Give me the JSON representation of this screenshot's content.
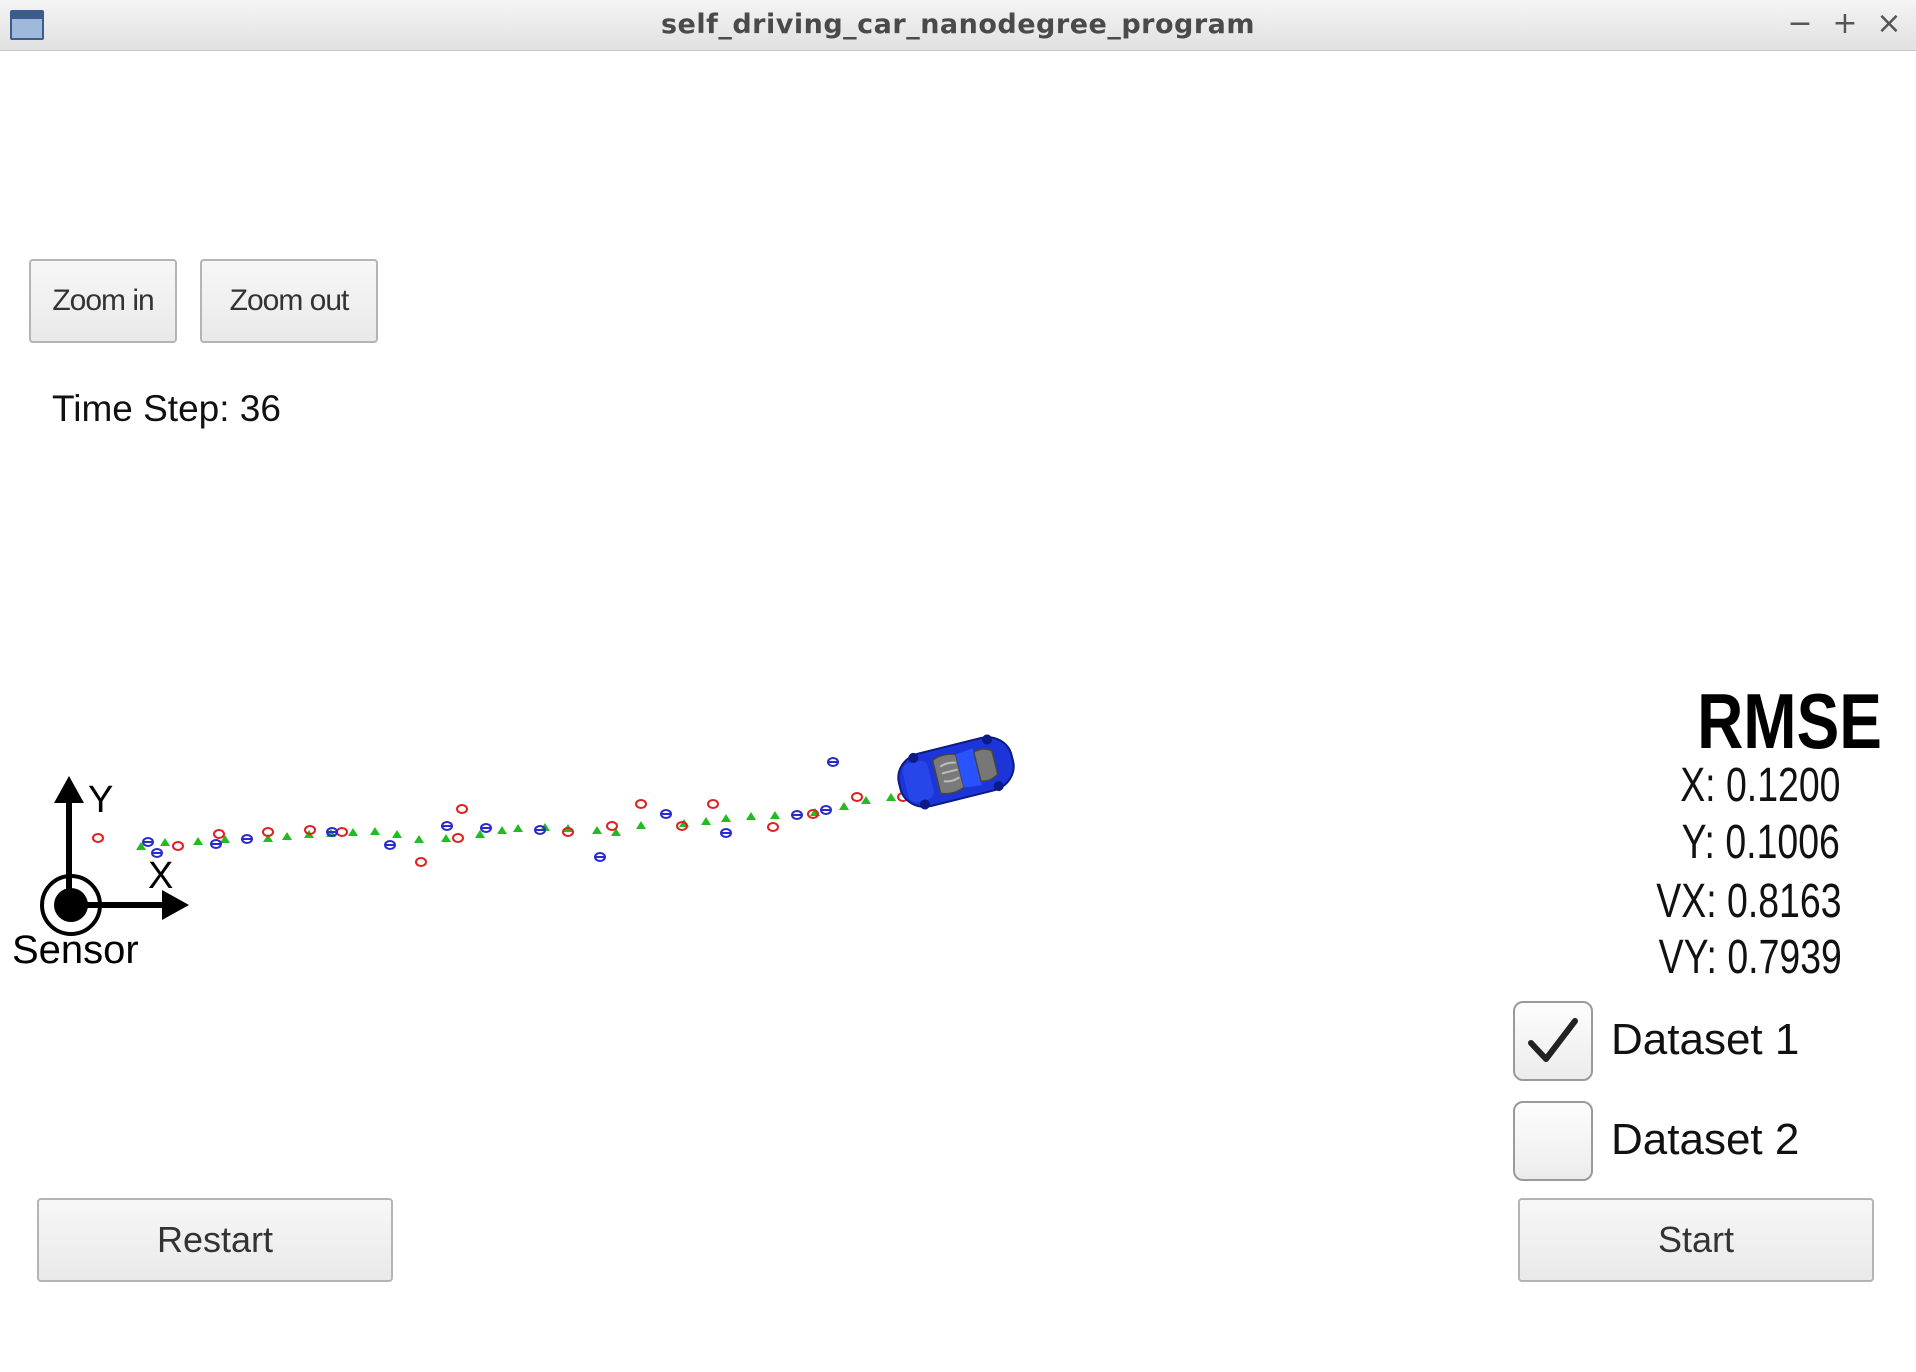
{
  "window": {
    "title": "self_driving_car_nanodegree_program",
    "controls": {
      "minimize": "−",
      "maximize": "+",
      "close": "×"
    }
  },
  "toolbar": {
    "zoom_in_label": "Zoom in",
    "zoom_out_label": "Zoom out"
  },
  "status": {
    "time_step_label": "Time Step: 36"
  },
  "scene": {
    "axis_y_label": "Y",
    "axis_x_label": "X",
    "sensor_label": "Sensor",
    "colors": {
      "lidar": "#e02020",
      "radar": "#2a2ad0",
      "estimate": "#22bb22",
      "car": "#1c35d9"
    }
  },
  "rmse": {
    "title": "RMSE",
    "x": "X: 0.1200",
    "y": "Y: 0.1006",
    "vx": "VX: 0.8163",
    "vy": "VY: 0.7939"
  },
  "datasets": {
    "dataset1_label": "Dataset 1",
    "dataset1_checked": true,
    "dataset2_label": "Dataset 2",
    "dataset2_checked": false
  },
  "actions": {
    "restart_label": "Restart",
    "start_label": "Start"
  }
}
